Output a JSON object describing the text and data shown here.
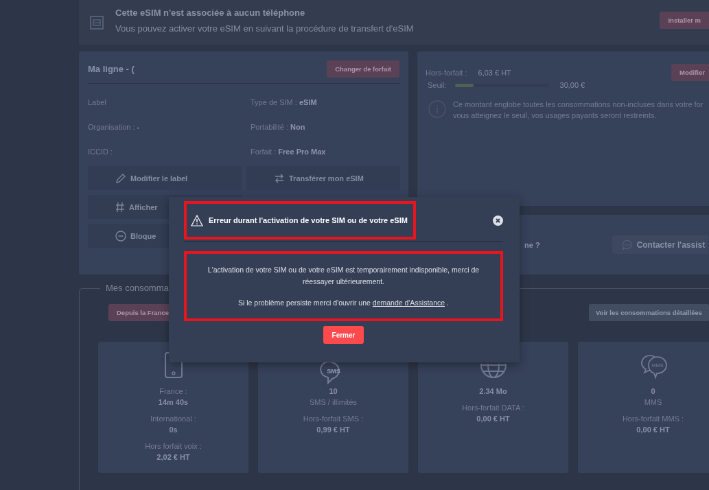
{
  "banner": {
    "title": "Cette eSIM n'est associée à aucun téléphone",
    "text": "Vous pouvez activer votre eSIM en suivant la procédure de transfert d'eSIM",
    "button": "Installer m"
  },
  "line_card": {
    "title": "Ma ligne - (",
    "button": "Changer de forfait",
    "fields": [
      {
        "label": "Label"
      },
      {
        "label": "Type de SIM :",
        "value": "eSIM"
      },
      {
        "label": "Organisation :",
        "value": "-"
      },
      {
        "label": "Portabilité :",
        "value": "Non"
      },
      {
        "label": "ICCID :"
      },
      {
        "label": "Forfait :",
        "value": "Free Pro Max"
      }
    ],
    "actions": [
      {
        "kind": "pencil",
        "label": "Modifier le label"
      },
      {
        "kind": "swap",
        "label": "Transférer mon eSIM"
      },
      {
        "kind": "hash",
        "label": "Afficher"
      },
      {
        "kind": "minus",
        "label": "Bloque"
      }
    ]
  },
  "overage_card": {
    "label": "Hors-forfait :",
    "amount": "6,03 € HT",
    "button": "Modifier",
    "threshold_label": "Seuil:",
    "level": 0.2,
    "threshold": "30,00 €",
    "info": [
      "Ce montant englobe toutes les consommations non-incluses dans votre for",
      "vous atteignez le seuil, vos usages payants seront restreints."
    ]
  },
  "support_card": {
    "question": "ne ?",
    "button": "Contacter l'assist"
  },
  "consumption": {
    "legend": "Mes consomma",
    "filter": "Depuis la France",
    "details_button": "Voir les consommations détaillées",
    "cards": [
      {
        "lines": [
          {
            "kind": "label",
            "text": "France :"
          },
          {
            "kind": "value",
            "text": "14m 40s"
          },
          {
            "kind": "label",
            "text": "International :"
          },
          {
            "kind": "value",
            "text": "0s"
          },
          {
            "kind": "label",
            "text": "Hors forfait voix :"
          },
          {
            "kind": "value",
            "text": "2,02 € HT"
          }
        ]
      },
      {
        "icon_label": "SMS",
        "lines": [
          {
            "kind": "value",
            "text": "10"
          },
          {
            "kind": "label",
            "text": "SMS / illimités"
          },
          {
            "kind": "label",
            "text": "Hors-forfait SMS :"
          },
          {
            "kind": "value",
            "text": "0,99 € HT"
          }
        ]
      },
      {
        "lines": [
          {
            "kind": "value",
            "text": "2.34 Mo"
          },
          {
            "kind": "label",
            "text": "Hors-forfait DATA :"
          },
          {
            "kind": "value",
            "text": "0,00 € HT"
          }
        ]
      },
      {
        "icon_label": "MMS",
        "lines": [
          {
            "kind": "value",
            "text": "0"
          },
          {
            "kind": "label",
            "text": "MMS"
          },
          {
            "kind": "label",
            "text": "Hors-forfait MMS :"
          },
          {
            "kind": "value",
            "text": "0,00 € HT"
          }
        ]
      }
    ]
  },
  "dialog": {
    "title": "Erreur durant l'activation de votre SIM ou de votre eSIM",
    "message": "L'activation de votre SIM ou de votre eSIM est temporairement indisponible, merci de réessayer ultérieurement.",
    "hint": "Si le problème persiste merci d'ouvrir une",
    "link": "demande d'Assistance",
    "hint_end": ".",
    "button": "Fermer",
    "highlighted": true
  }
}
